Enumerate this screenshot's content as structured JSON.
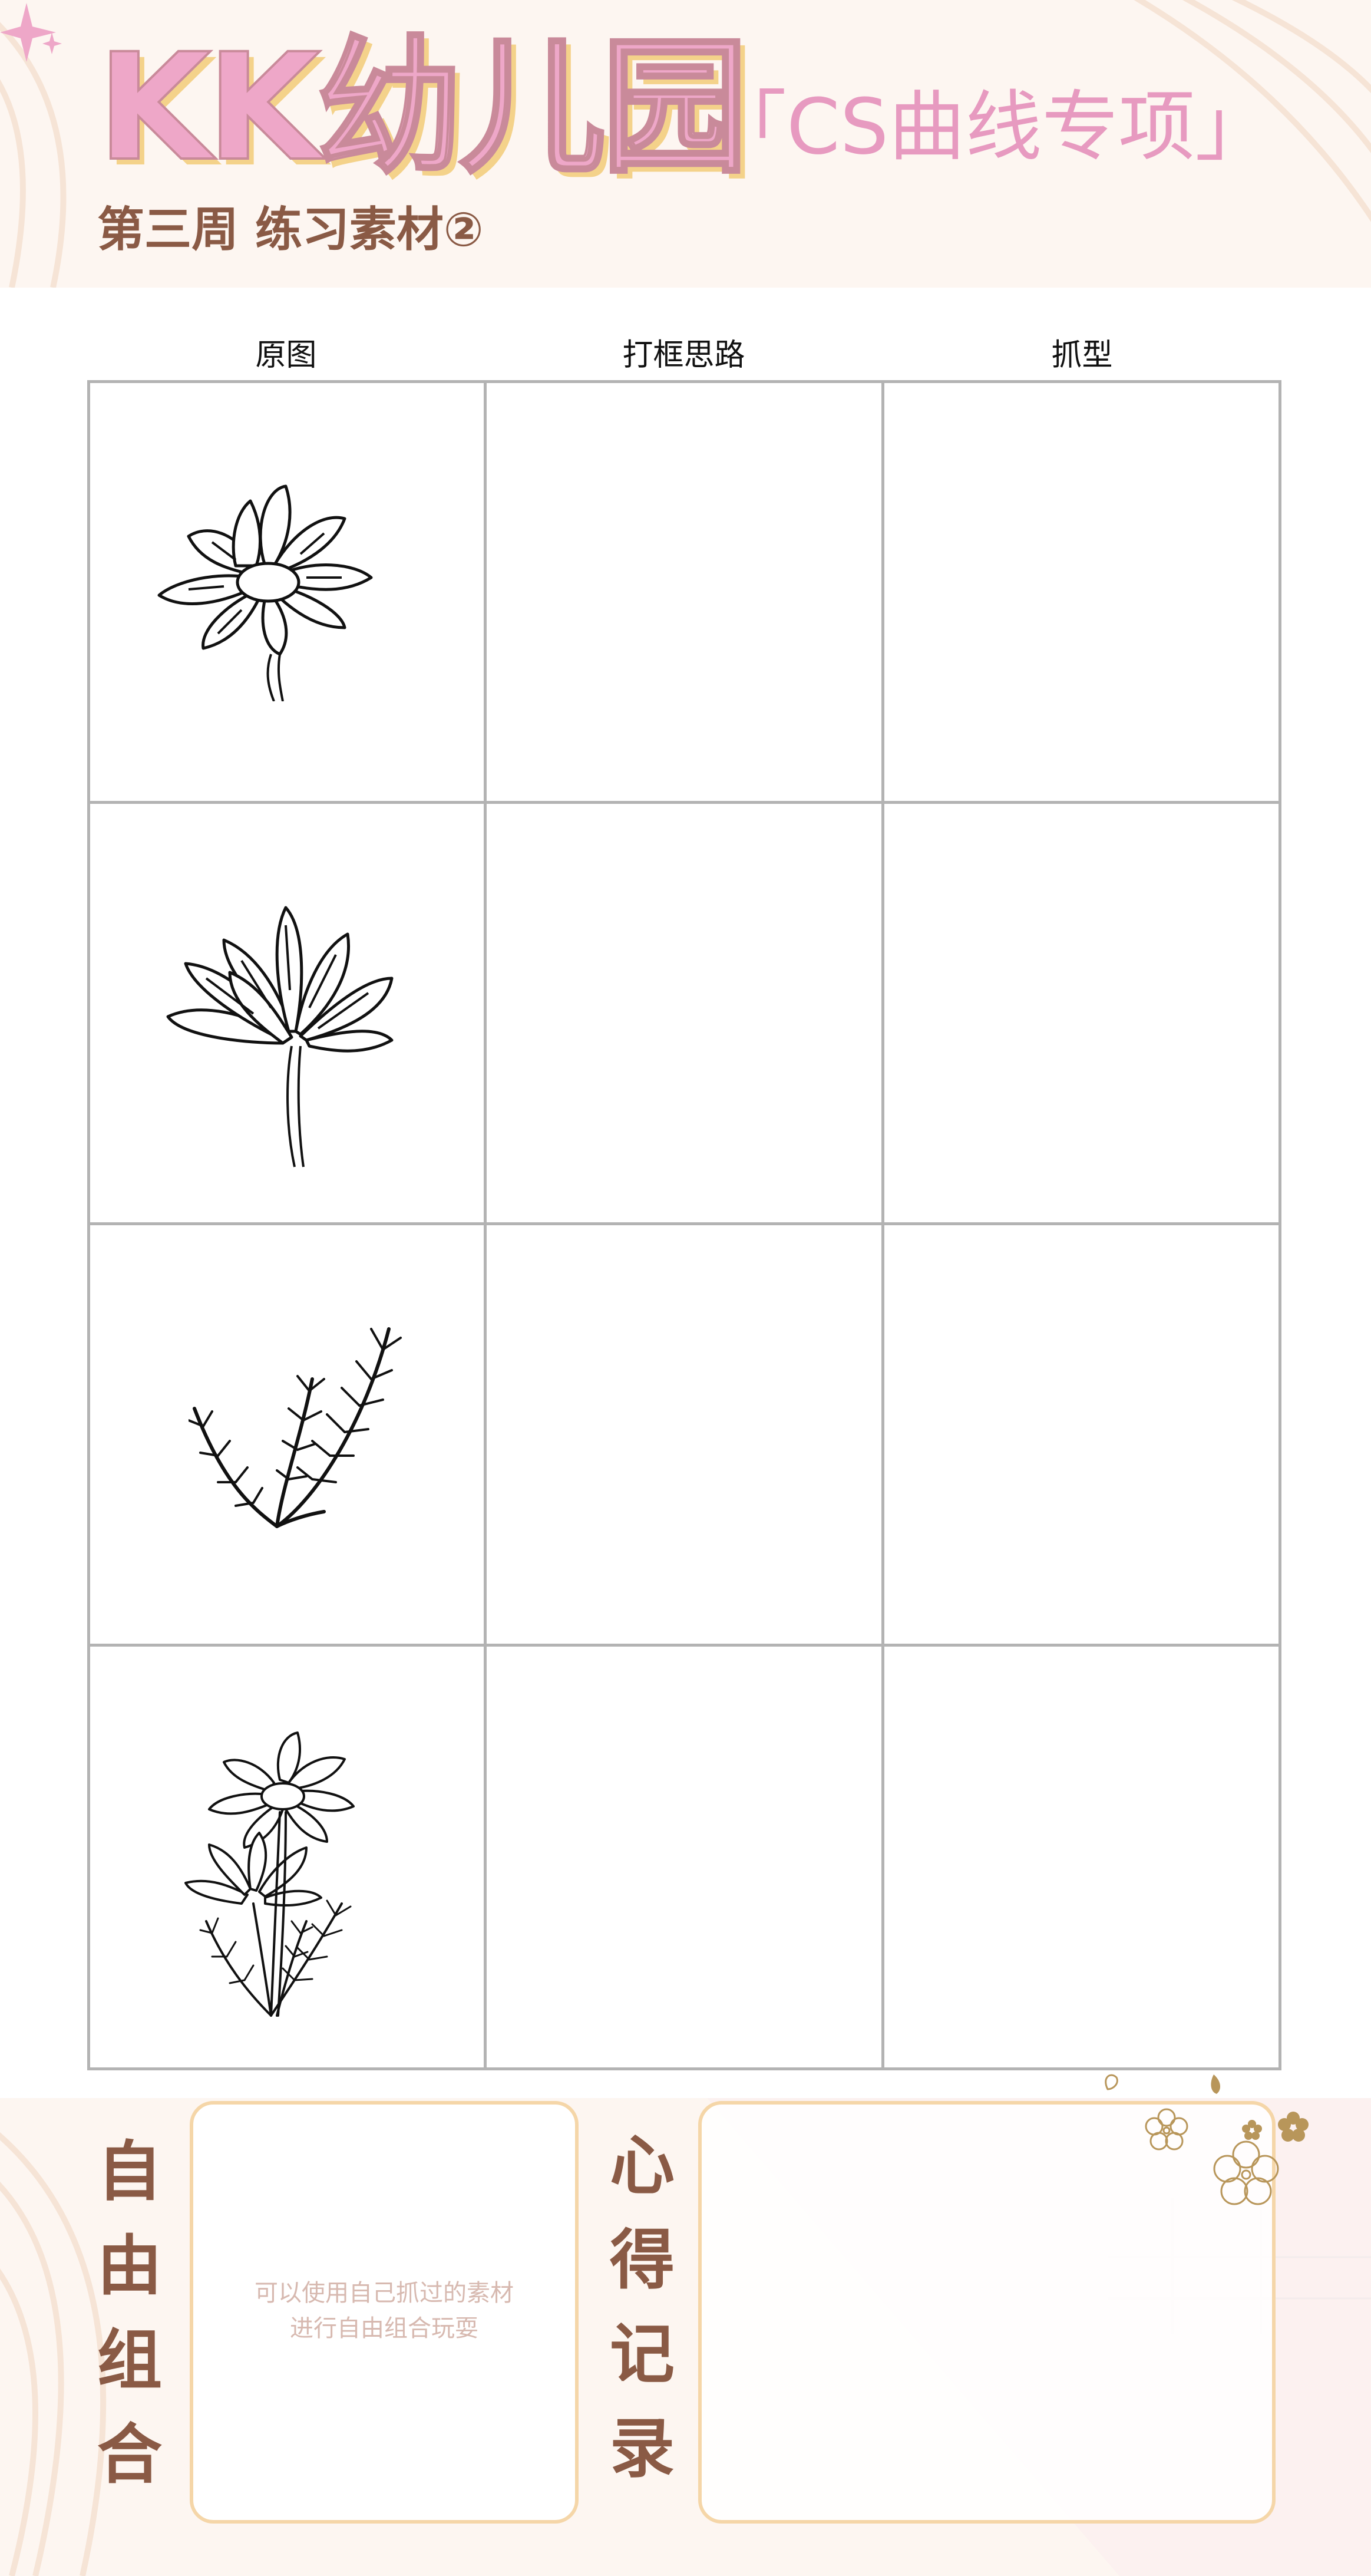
{
  "header": {
    "title": "KK幼儿园",
    "subtitle_tag": "「CS曲线专项」",
    "week_line": "第三周  练习素材②"
  },
  "table": {
    "columns": [
      "原图",
      "打框思路",
      "抓型"
    ],
    "rows": [
      {
        "reference": "daisy-single-icon"
      },
      {
        "reference": "daisy-side-icon"
      },
      {
        "reference": "fern-sprig-icon"
      },
      {
        "reference": "daisy-bouquet-icon"
      }
    ]
  },
  "footer": {
    "free_combo_label": [
      "自",
      "由",
      "组",
      "合"
    ],
    "free_combo_hint_line1": "可以使用自己抓过的素材",
    "free_combo_hint_line2": "进行自由组合玩耍",
    "notes_label": [
      "心",
      "得",
      "记",
      "录"
    ]
  },
  "colors": {
    "title_pink": "#eea7c8",
    "title_shadow": "#f4d28a",
    "brown_text": "#8a5a45",
    "grid_gray": "#b3b3b3",
    "box_border": "#f5d6a8",
    "band_bg": "#fdf6f1"
  }
}
